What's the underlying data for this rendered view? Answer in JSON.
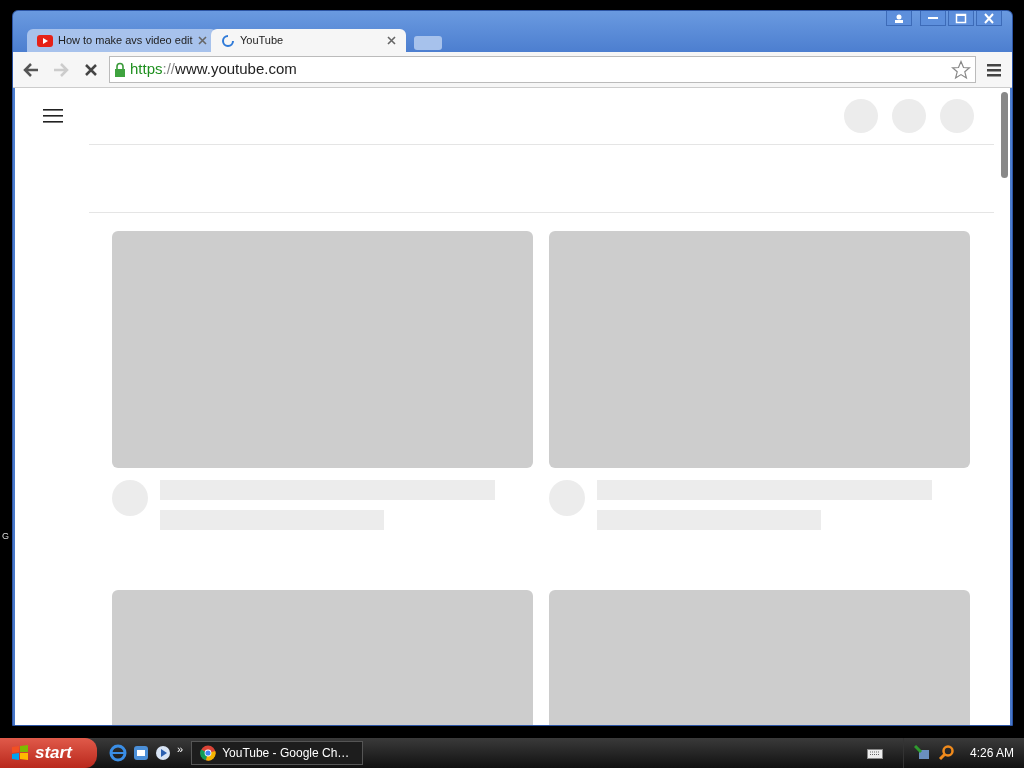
{
  "desktop": {
    "edge_text": "G"
  },
  "window": {
    "tabs": [
      {
        "title": "How to make avs video edit",
        "kind": "youtube",
        "selected": false
      },
      {
        "title": "YouTube",
        "kind": "loading",
        "selected": true
      }
    ],
    "toolbar": {
      "forward_enabled": false,
      "loading": true,
      "url": {
        "scheme": "https",
        "separator": "://",
        "host": "www.youtube.com"
      },
      "bookmarked": false
    }
  },
  "taskbar": {
    "start": "start",
    "more": "»",
    "tasks": [
      {
        "title": "YouTube - Google Ch…",
        "selected": false
      }
    ],
    "clock": "4:26 AM"
  }
}
